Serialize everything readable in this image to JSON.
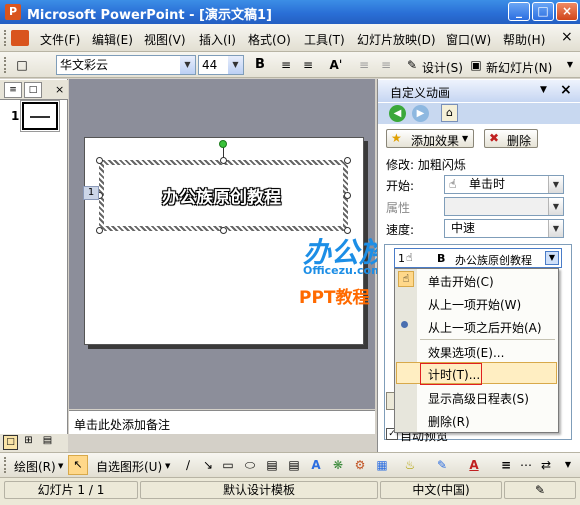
{
  "window": {
    "title": "Microsoft PowerPoint - [演示文稿1]",
    "app_icon": "P",
    "buttons": [
      "_",
      "□",
      "×"
    ]
  },
  "menubar": {
    "items": [
      "文件(F)",
      "编辑(E)",
      "视图(V)",
      "插入(I)",
      "格式(O)",
      "工具(T)",
      "幻灯片放映(D)",
      "窗口(W)",
      "帮助(H)"
    ],
    "close": "×"
  },
  "toolbar": {
    "font": "华文彩云",
    "size": "44",
    "bold": "B",
    "design_label": "设计(S)",
    "new_slide_label": "新幻灯片(N)"
  },
  "slides_pane": {
    "slide_number": "1"
  },
  "slide": {
    "title_text": "办公族原创教程",
    "anim_tag": "1"
  },
  "notes": {
    "placeholder": "单击此处添加备注"
  },
  "taskpane": {
    "title": "自定义动画",
    "add_effect": "添加效果",
    "remove": "删除",
    "modify_label": "修改: 加粗闪烁",
    "start_label": "开始:",
    "start_value": "单击时",
    "property_label": "属性",
    "speed_label": "速度:",
    "speed_value": "中速",
    "list_item": {
      "index": "1",
      "bold_mark": "B",
      "name": "办公族原创教程"
    },
    "auto_preview": "自动预览"
  },
  "context_menu": {
    "items": [
      "单击开始(C)",
      "从上一项开始(W)",
      "从上一项之后开始(A)",
      "效果选项(E)...",
      "计时(T)...",
      "显示高级日程表(S)",
      "删除(R)"
    ],
    "highlighted": "计时(T)..."
  },
  "watermark": {
    "line1": "办公族",
    "line2": "Officezu.com",
    "line3": "PPT教程"
  },
  "drawbar": {
    "draw_label": "绘图(R)",
    "autoshape_label": "自选图形(U)"
  },
  "statusbar": {
    "slide_info": "幻灯片 1 / 1",
    "template": "默认设计模板",
    "language": "中文(中国)"
  }
}
